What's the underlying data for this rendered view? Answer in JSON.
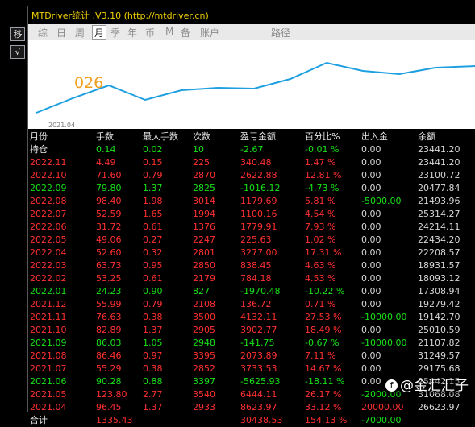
{
  "window": {
    "title": "MTDriver统计 ,V3.10 (http://mtdriver.cn)"
  },
  "toolbar": {
    "btn1": "移",
    "btn2": "√"
  },
  "tabs": [
    "综",
    "日",
    "周",
    "月",
    "季",
    "年",
    "币",
    "M",
    "备",
    "账户",
    "路径"
  ],
  "active_tab": "月",
  "chart": {
    "label": "026",
    "start_date": "2021.04"
  },
  "table": {
    "headers": [
      "月份",
      "手数",
      "最大手数",
      "次数",
      "盈亏金额",
      "百分比%",
      "出入金",
      "余额"
    ],
    "holding": [
      "持仓",
      "0.14",
      "0.02",
      "10",
      "-2.67",
      "-0.01 %",
      "0.00",
      "23441.20"
    ],
    "rows": [
      [
        "2022.11",
        "4.49",
        "0.15",
        "225",
        "340.48",
        "1.47 %",
        "0.00",
        "23441.20"
      ],
      [
        "2022.10",
        "71.60",
        "0.79",
        "2870",
        "2622.88",
        "12.81 %",
        "0.00",
        "23100.72"
      ],
      [
        "2022.09",
        "79.80",
        "1.37",
        "2825",
        "-1016.12",
        "-4.73 %",
        "0.00",
        "20477.84"
      ],
      [
        "2022.08",
        "98.40",
        "1.98",
        "3014",
        "1179.69",
        "5.81 %",
        "-5000.00",
        "21493.96"
      ],
      [
        "2022.07",
        "52.59",
        "1.65",
        "1994",
        "1100.16",
        "4.54 %",
        "0.00",
        "25314.27"
      ],
      [
        "2022.06",
        "31.72",
        "0.61",
        "1376",
        "1779.91",
        "7.93 %",
        "0.00",
        "24214.11"
      ],
      [
        "2022.05",
        "49.06",
        "0.27",
        "2247",
        "225.63",
        "1.02 %",
        "0.00",
        "22434.20"
      ],
      [
        "2022.04",
        "52.60",
        "0.32",
        "2801",
        "3277.00",
        "17.31 %",
        "0.00",
        "22208.57"
      ],
      [
        "2022.03",
        "63.73",
        "0.95",
        "2850",
        "838.45",
        "4.63 %",
        "0.00",
        "18931.57"
      ],
      [
        "2022.02",
        "53.25",
        "0.61",
        "2179",
        "784.18",
        "4.53 %",
        "0.00",
        "18093.12"
      ],
      [
        "2022.01",
        "24.23",
        "0.90",
        "827",
        "-1970.48",
        "-10.22 %",
        "0.00",
        "17308.94"
      ],
      [
        "2021.12",
        "55.99",
        "0.79",
        "2108",
        "136.72",
        "0.71 %",
        "0.00",
        "19279.42"
      ],
      [
        "2021.11",
        "76.63",
        "0.38",
        "3500",
        "4132.11",
        "27.53 %",
        "-10000.00",
        "19142.70"
      ],
      [
        "2021.10",
        "82.89",
        "1.37",
        "2905",
        "3902.77",
        "18.49 %",
        "0.00",
        "25010.59"
      ],
      [
        "2021.09",
        "86.03",
        "1.05",
        "2948",
        "-141.75",
        "-0.67 %",
        "-10000.00",
        "21107.82"
      ],
      [
        "2021.08",
        "86.46",
        "0.97",
        "3395",
        "2073.89",
        "7.11 %",
        "0.00",
        "31249.57"
      ],
      [
        "2021.07",
        "55.29",
        "0.38",
        "2852",
        "3733.53",
        "14.67 %",
        "0.00",
        "29175.68"
      ],
      [
        "2021.06",
        "90.28",
        "0.88",
        "3397",
        "-5625.93",
        "-18.11 %",
        "0.00",
        "25442.15"
      ],
      [
        "2021.05",
        "123.80",
        "2.77",
        "3540",
        "6444.11",
        "26.17 %",
        "-2000.00",
        "31068.08"
      ],
      [
        "2021.04",
        "96.45",
        "1.37",
        "2933",
        "8623.97",
        "33.12 %",
        "20000.00",
        "26623.97"
      ]
    ],
    "total": [
      "合计",
      "1335.43",
      "",
      "",
      "30438.53",
      "154.13 %",
      "-7000.00",
      ""
    ]
  },
  "colors": {
    "positive": "#ff3030",
    "negative": "#18e018",
    "neutral": "#d8d8d8",
    "line": "#1ea0e0",
    "title": "#f0d000"
  },
  "watermark": {
    "logo": "f",
    "text": "@金汇汇子"
  }
}
